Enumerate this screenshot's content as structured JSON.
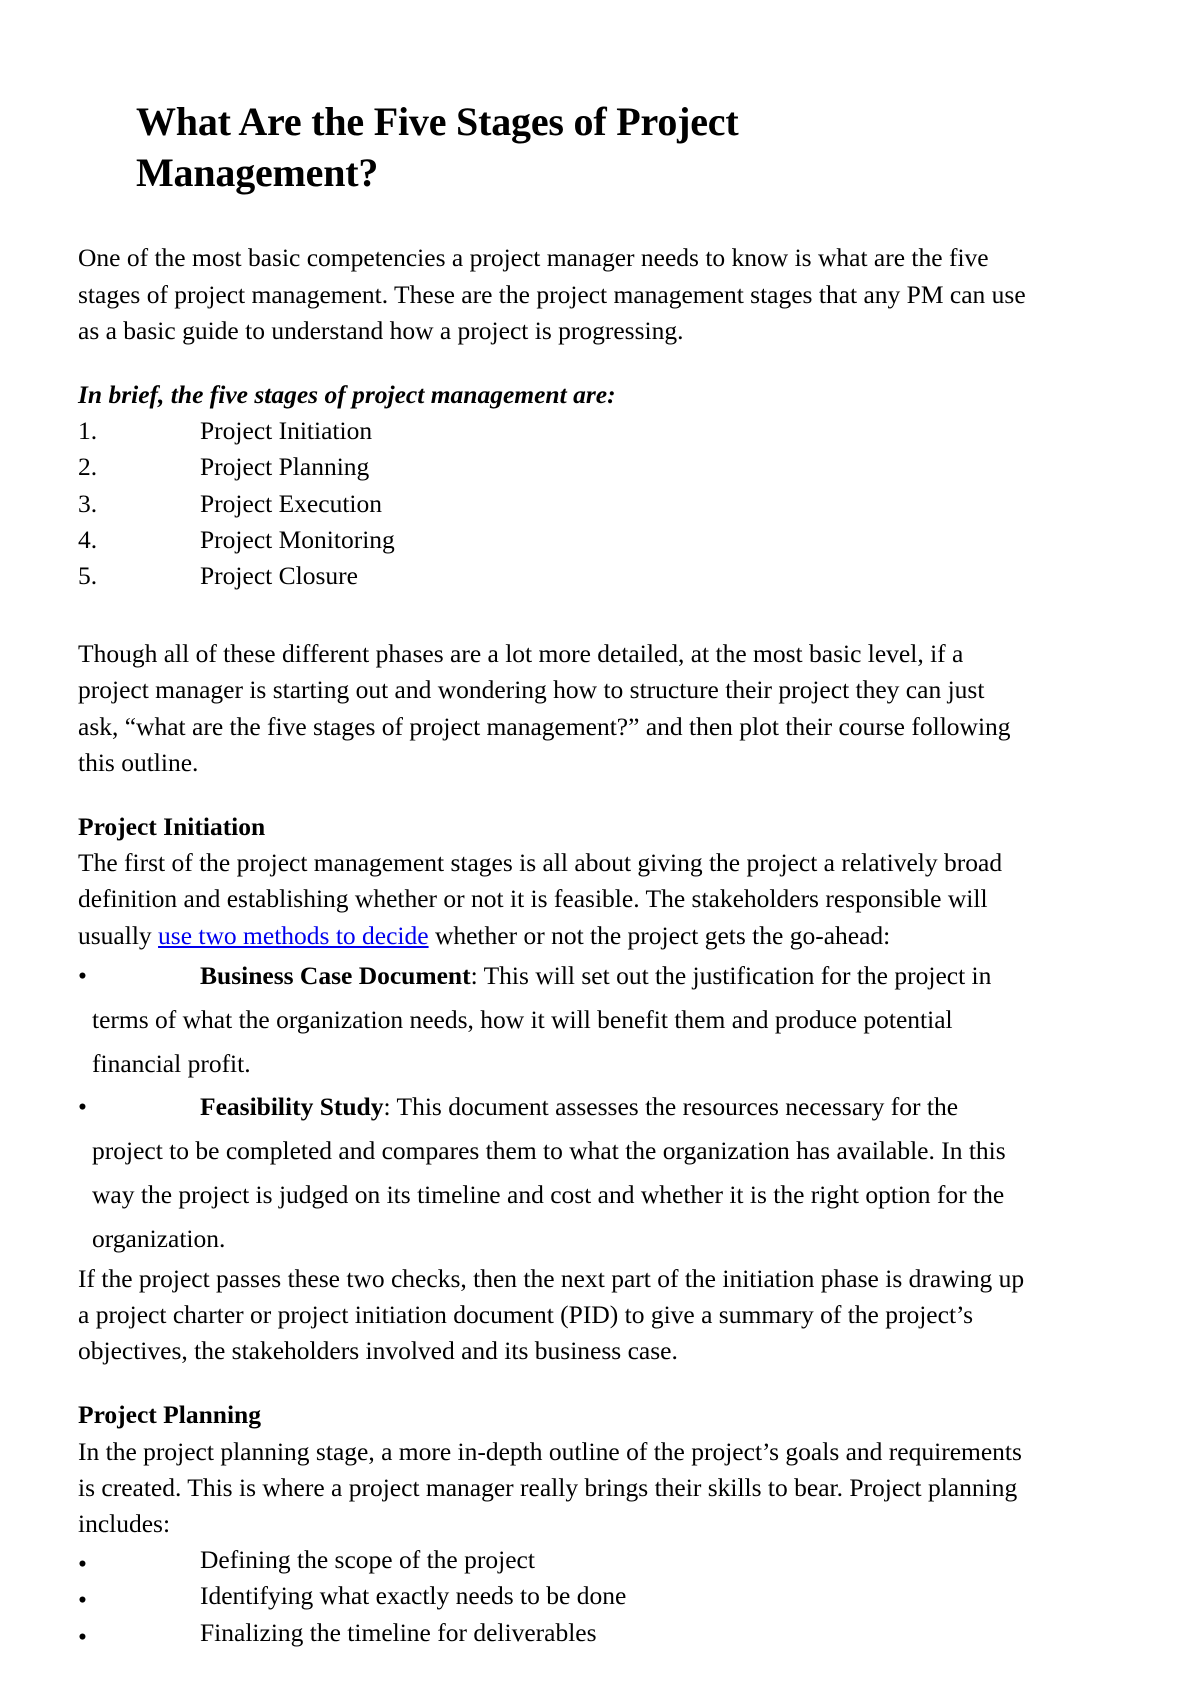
{
  "document": {
    "title": "What Are the Five Stages of Project Management?",
    "intro_paragraph": "One of the most basic competencies a project manager needs to know is what are the five stages of project management. These are the project management stages that any PM can use as a basic guide to understand how a project is progressing.",
    "lead_in": "In brief, the five stages of project management are:",
    "stages_list": [
      {
        "number": "1.",
        "label": "Project Initiation"
      },
      {
        "number": "2.",
        "label": "Project Planning"
      },
      {
        "number": "3.",
        "label": "Project Execution"
      },
      {
        "number": "4.",
        "label": "Project Monitoring"
      },
      {
        "number": "5.",
        "label": "Project Closure"
      }
    ],
    "though_paragraph": "Though all of these different phases are a lot more detailed, at the most basic level, if a project manager is starting out and wondering how to structure their project they can just ask, “what are the five stages of project management?” and then plot their course following this outline.",
    "sections": [
      {
        "heading": "Project Initiation",
        "intro_before_link": "The first of the project management stages is all about giving the project a relatively broad definition and establishing whether or not it is feasible. The stakeholders responsible will usually ",
        "link_text": "use two methods to decide",
        "intro_after_link": " whether or not the project gets the go-ahead:",
        "bullets": [
          {
            "bullet_glyph": "•",
            "bold_lead": "Business Case Document",
            "rest": ": This will set out the justification for the project in terms of what the organization needs, how it will benefit them and produce potential financial profit."
          },
          {
            "bullet_glyph": "•",
            "bold_lead": "Feasibility Study",
            "rest": ": This document assesses the resources necessary for the project to be completed and compares them to what the organization has available. In this way the project is judged on its timeline and cost and whether it is the right option for the organization."
          }
        ],
        "closing_paragraph": "If the project passes these two checks, then the next part of the initiation phase is drawing up a project charter or project initiation document (PID) to give a summary of the project’s objectives, the stakeholders involved and its business case."
      },
      {
        "heading": "Project Planning",
        "paragraph": "In the project planning stage, a more in-depth outline of the project’s goals and requirements is created. This is where a project manager really brings their skills to bear. Project planning includes:",
        "bullets": [
          {
            "bullet_glyph": "•",
            "text": "Defining the scope of the project"
          },
          {
            "bullet_glyph": "•",
            "text": "Identifying what exactly needs to be done"
          },
          {
            "bullet_glyph": "•",
            "text": "Finalizing the timeline for deliverables"
          }
        ]
      }
    ],
    "link_color": "#0000ee",
    "text_color": "#000000",
    "background_color": "#ffffff"
  }
}
